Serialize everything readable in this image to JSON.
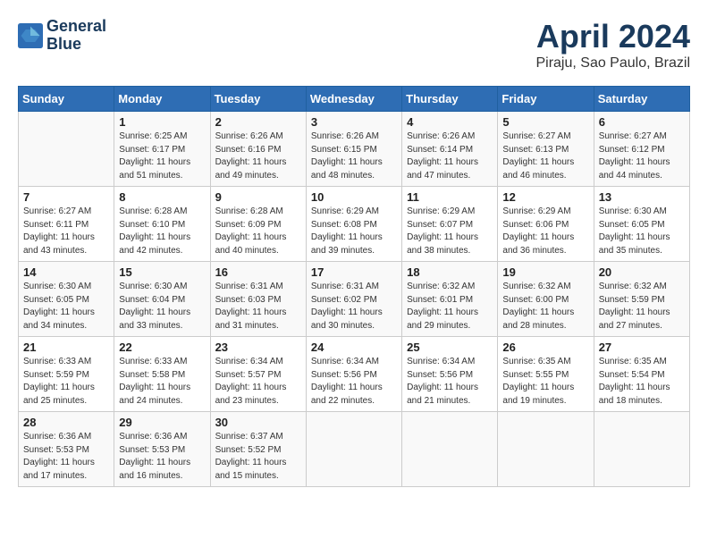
{
  "header": {
    "logo_line1": "General",
    "logo_line2": "Blue",
    "month": "April 2024",
    "location": "Piraju, Sao Paulo, Brazil"
  },
  "days_of_week": [
    "Sunday",
    "Monday",
    "Tuesday",
    "Wednesday",
    "Thursday",
    "Friday",
    "Saturday"
  ],
  "weeks": [
    [
      {
        "day": "",
        "info": ""
      },
      {
        "day": "1",
        "info": "Sunrise: 6:25 AM\nSunset: 6:17 PM\nDaylight: 11 hours\nand 51 minutes."
      },
      {
        "day": "2",
        "info": "Sunrise: 6:26 AM\nSunset: 6:16 PM\nDaylight: 11 hours\nand 49 minutes."
      },
      {
        "day": "3",
        "info": "Sunrise: 6:26 AM\nSunset: 6:15 PM\nDaylight: 11 hours\nand 48 minutes."
      },
      {
        "day": "4",
        "info": "Sunrise: 6:26 AM\nSunset: 6:14 PM\nDaylight: 11 hours\nand 47 minutes."
      },
      {
        "day": "5",
        "info": "Sunrise: 6:27 AM\nSunset: 6:13 PM\nDaylight: 11 hours\nand 46 minutes."
      },
      {
        "day": "6",
        "info": "Sunrise: 6:27 AM\nSunset: 6:12 PM\nDaylight: 11 hours\nand 44 minutes."
      }
    ],
    [
      {
        "day": "7",
        "info": "Sunrise: 6:27 AM\nSunset: 6:11 PM\nDaylight: 11 hours\nand 43 minutes."
      },
      {
        "day": "8",
        "info": "Sunrise: 6:28 AM\nSunset: 6:10 PM\nDaylight: 11 hours\nand 42 minutes."
      },
      {
        "day": "9",
        "info": "Sunrise: 6:28 AM\nSunset: 6:09 PM\nDaylight: 11 hours\nand 40 minutes."
      },
      {
        "day": "10",
        "info": "Sunrise: 6:29 AM\nSunset: 6:08 PM\nDaylight: 11 hours\nand 39 minutes."
      },
      {
        "day": "11",
        "info": "Sunrise: 6:29 AM\nSunset: 6:07 PM\nDaylight: 11 hours\nand 38 minutes."
      },
      {
        "day": "12",
        "info": "Sunrise: 6:29 AM\nSunset: 6:06 PM\nDaylight: 11 hours\nand 36 minutes."
      },
      {
        "day": "13",
        "info": "Sunrise: 6:30 AM\nSunset: 6:05 PM\nDaylight: 11 hours\nand 35 minutes."
      }
    ],
    [
      {
        "day": "14",
        "info": "Sunrise: 6:30 AM\nSunset: 6:05 PM\nDaylight: 11 hours\nand 34 minutes."
      },
      {
        "day": "15",
        "info": "Sunrise: 6:30 AM\nSunset: 6:04 PM\nDaylight: 11 hours\nand 33 minutes."
      },
      {
        "day": "16",
        "info": "Sunrise: 6:31 AM\nSunset: 6:03 PM\nDaylight: 11 hours\nand 31 minutes."
      },
      {
        "day": "17",
        "info": "Sunrise: 6:31 AM\nSunset: 6:02 PM\nDaylight: 11 hours\nand 30 minutes."
      },
      {
        "day": "18",
        "info": "Sunrise: 6:32 AM\nSunset: 6:01 PM\nDaylight: 11 hours\nand 29 minutes."
      },
      {
        "day": "19",
        "info": "Sunrise: 6:32 AM\nSunset: 6:00 PM\nDaylight: 11 hours\nand 28 minutes."
      },
      {
        "day": "20",
        "info": "Sunrise: 6:32 AM\nSunset: 5:59 PM\nDaylight: 11 hours\nand 27 minutes."
      }
    ],
    [
      {
        "day": "21",
        "info": "Sunrise: 6:33 AM\nSunset: 5:59 PM\nDaylight: 11 hours\nand 25 minutes."
      },
      {
        "day": "22",
        "info": "Sunrise: 6:33 AM\nSunset: 5:58 PM\nDaylight: 11 hours\nand 24 minutes."
      },
      {
        "day": "23",
        "info": "Sunrise: 6:34 AM\nSunset: 5:57 PM\nDaylight: 11 hours\nand 23 minutes."
      },
      {
        "day": "24",
        "info": "Sunrise: 6:34 AM\nSunset: 5:56 PM\nDaylight: 11 hours\nand 22 minutes."
      },
      {
        "day": "25",
        "info": "Sunrise: 6:34 AM\nSunset: 5:56 PM\nDaylight: 11 hours\nand 21 minutes."
      },
      {
        "day": "26",
        "info": "Sunrise: 6:35 AM\nSunset: 5:55 PM\nDaylight: 11 hours\nand 19 minutes."
      },
      {
        "day": "27",
        "info": "Sunrise: 6:35 AM\nSunset: 5:54 PM\nDaylight: 11 hours\nand 18 minutes."
      }
    ],
    [
      {
        "day": "28",
        "info": "Sunrise: 6:36 AM\nSunset: 5:53 PM\nDaylight: 11 hours\nand 17 minutes."
      },
      {
        "day": "29",
        "info": "Sunrise: 6:36 AM\nSunset: 5:53 PM\nDaylight: 11 hours\nand 16 minutes."
      },
      {
        "day": "30",
        "info": "Sunrise: 6:37 AM\nSunset: 5:52 PM\nDaylight: 11 hours\nand 15 minutes."
      },
      {
        "day": "",
        "info": ""
      },
      {
        "day": "",
        "info": ""
      },
      {
        "day": "",
        "info": ""
      },
      {
        "day": "",
        "info": ""
      }
    ]
  ]
}
